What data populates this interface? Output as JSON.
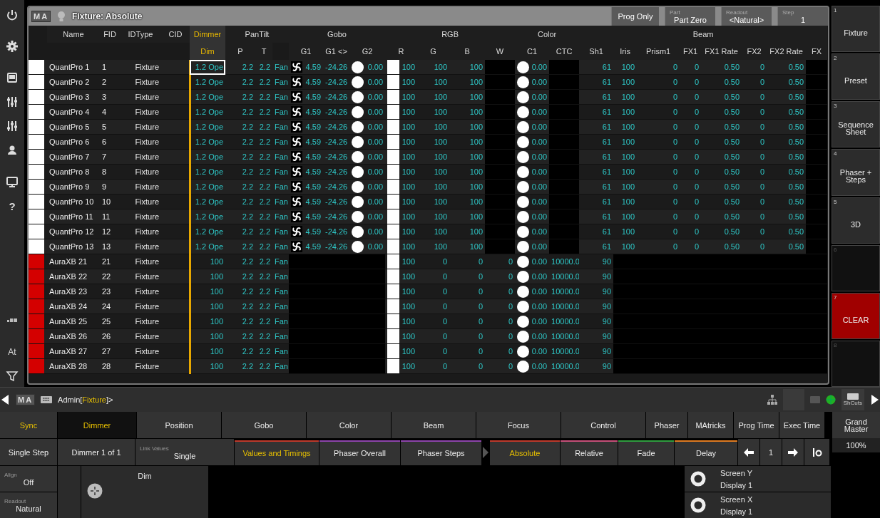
{
  "left_toolbar": {
    "help": "?",
    "at": "At"
  },
  "window": {
    "logo": "MA",
    "title": "Fixture: Absolute",
    "controls": [
      {
        "value": "Prog Only"
      },
      {
        "caption": "Part",
        "value": "Part Zero"
      },
      {
        "caption": "Readout",
        "value": "<Natural>"
      },
      {
        "caption": "Step",
        "value": "1"
      }
    ]
  },
  "table": {
    "groups": [
      {
        "label": "Name",
        "selected": false,
        "columns": [
          {
            "kind": "info"
          }
        ]
      },
      {
        "label": "FID",
        "selected": false,
        "columns": [
          {
            "kind": "info"
          }
        ]
      },
      {
        "label": "IDType",
        "selected": false,
        "columns": [
          {
            "kind": "info"
          }
        ]
      },
      {
        "label": "CID",
        "selected": false,
        "columns": [
          {
            "kind": "info"
          }
        ]
      },
      {
        "label": "Dimmer",
        "selected": true,
        "columns": [
          {
            "label": "Dim",
            "kind": "attr"
          }
        ]
      },
      {
        "label": "PanTilt",
        "selected": false,
        "columns": [
          {
            "label": "P",
            "kind": "attr"
          },
          {
            "label": "T",
            "kind": "attr"
          },
          {
            "kind": "attr"
          }
        ]
      },
      {
        "label": "Gobo",
        "selected": false,
        "columns": [
          {
            "label": "G1",
            "kind": "gobo"
          },
          {
            "label": "G1 <>",
            "kind": "attr"
          },
          {
            "label": "G2",
            "kind": "wheel"
          }
        ]
      },
      {
        "label": "RGB",
        "selected": false,
        "columns": [
          {
            "label": "R",
            "kind": "swatch"
          },
          {
            "label": "G",
            "kind": "attr"
          },
          {
            "label": "B",
            "kind": "attr"
          },
          {
            "label": "W",
            "kind": "attr"
          }
        ]
      },
      {
        "label": "Color",
        "selected": false,
        "columns": [
          {
            "label": "C1",
            "kind": "wheel"
          },
          {
            "label": "CTC",
            "kind": "attr"
          }
        ]
      },
      {
        "label": "Beam",
        "selected": false,
        "columns": [
          {
            "label": "Sh1",
            "kind": "attr"
          },
          {
            "label": "Iris",
            "kind": "attr"
          },
          {
            "label": "Prism1",
            "kind": "attr"
          },
          {
            "label": "FX1",
            "kind": "attr"
          },
          {
            "label": "FX1 Rate",
            "kind": "attr"
          },
          {
            "label": "FX2",
            "kind": "attr"
          },
          {
            "label": "FX2 Rate",
            "kind": "attr"
          },
          {
            "label": "FX",
            "kind": "attr"
          }
        ]
      }
    ],
    "rows": [
      {
        "color": "#ffffff",
        "selected": true,
        "cells": [
          "QuantPro 1",
          "1",
          "Fixture",
          null,
          "1.2 Ope",
          "2.2",
          "2.2",
          "Fan",
          "4.59",
          "-24.26",
          "0.00",
          "100",
          "100",
          "100",
          null,
          "0.00",
          null,
          "61",
          "100",
          "0",
          "0",
          "0.50",
          "0",
          "0.50",
          null
        ]
      },
      {
        "color": "#ffffff",
        "selected": false,
        "cells": [
          "QuantPro 2",
          "2",
          "Fixture",
          null,
          "1.2 Ope",
          "2.2",
          "2.2",
          "Fan",
          "4.59",
          "-24.26",
          "0.00",
          "100",
          "100",
          "100",
          null,
          "0.00",
          null,
          "61",
          "100",
          "0",
          "0",
          "0.50",
          "0",
          "0.50",
          null
        ]
      },
      {
        "color": "#ffffff",
        "selected": false,
        "cells": [
          "QuantPro 3",
          "3",
          "Fixture",
          null,
          "1.2 Ope",
          "2.2",
          "2.2",
          "Fan",
          "4.59",
          "-24.26",
          "0.00",
          "100",
          "100",
          "100",
          null,
          "0.00",
          null,
          "61",
          "100",
          "0",
          "0",
          "0.50",
          "0",
          "0.50",
          null
        ]
      },
      {
        "color": "#ffffff",
        "selected": false,
        "cells": [
          "QuantPro 4",
          "4",
          "Fixture",
          null,
          "1.2 Ope",
          "2.2",
          "2.2",
          "Fan",
          "4.59",
          "-24.26",
          "0.00",
          "100",
          "100",
          "100",
          null,
          "0.00",
          null,
          "61",
          "100",
          "0",
          "0",
          "0.50",
          "0",
          "0.50",
          null
        ]
      },
      {
        "color": "#ffffff",
        "selected": false,
        "cells": [
          "QuantPro 5",
          "5",
          "Fixture",
          null,
          "1.2 Ope",
          "2.2",
          "2.2",
          "Fan",
          "4.59",
          "-24.26",
          "0.00",
          "100",
          "100",
          "100",
          null,
          "0.00",
          null,
          "61",
          "100",
          "0",
          "0",
          "0.50",
          "0",
          "0.50",
          null
        ]
      },
      {
        "color": "#ffffff",
        "selected": false,
        "cells": [
          "QuantPro 6",
          "6",
          "Fixture",
          null,
          "1.2 Ope",
          "2.2",
          "2.2",
          "Fan",
          "4.59",
          "-24.26",
          "0.00",
          "100",
          "100",
          "100",
          null,
          "0.00",
          null,
          "61",
          "100",
          "0",
          "0",
          "0.50",
          "0",
          "0.50",
          null
        ]
      },
      {
        "color": "#ffffff",
        "selected": false,
        "cells": [
          "QuantPro 7",
          "7",
          "Fixture",
          null,
          "1.2 Ope",
          "2.2",
          "2.2",
          "Fan",
          "4.59",
          "-24.26",
          "0.00",
          "100",
          "100",
          "100",
          null,
          "0.00",
          null,
          "61",
          "100",
          "0",
          "0",
          "0.50",
          "0",
          "0.50",
          null
        ]
      },
      {
        "color": "#ffffff",
        "selected": false,
        "cells": [
          "QuantPro 8",
          "8",
          "Fixture",
          null,
          "1.2 Ope",
          "2.2",
          "2.2",
          "Fan",
          "4.59",
          "-24.26",
          "0.00",
          "100",
          "100",
          "100",
          null,
          "0.00",
          null,
          "61",
          "100",
          "0",
          "0",
          "0.50",
          "0",
          "0.50",
          null
        ]
      },
      {
        "color": "#ffffff",
        "selected": false,
        "cells": [
          "QuantPro 9",
          "9",
          "Fixture",
          null,
          "1.2 Ope",
          "2.2",
          "2.2",
          "Fan",
          "4.59",
          "-24.26",
          "0.00",
          "100",
          "100",
          "100",
          null,
          "0.00",
          null,
          "61",
          "100",
          "0",
          "0",
          "0.50",
          "0",
          "0.50",
          null
        ]
      },
      {
        "color": "#ffffff",
        "selected": false,
        "cells": [
          "QuantPro 10",
          "10",
          "Fixture",
          null,
          "1.2 Ope",
          "2.2",
          "2.2",
          "Fan",
          "4.59",
          "-24.26",
          "0.00",
          "100",
          "100",
          "100",
          null,
          "0.00",
          null,
          "61",
          "100",
          "0",
          "0",
          "0.50",
          "0",
          "0.50",
          null
        ]
      },
      {
        "color": "#ffffff",
        "selected": false,
        "cells": [
          "QuantPro 11",
          "11",
          "Fixture",
          null,
          "1.2 Ope",
          "2.2",
          "2.2",
          "Fan",
          "4.59",
          "-24.26",
          "0.00",
          "100",
          "100",
          "100",
          null,
          "0.00",
          null,
          "61",
          "100",
          "0",
          "0",
          "0.50",
          "0",
          "0.50",
          null
        ]
      },
      {
        "color": "#ffffff",
        "selected": false,
        "cells": [
          "QuantPro 12",
          "12",
          "Fixture",
          null,
          "1.2 Ope",
          "2.2",
          "2.2",
          "Fan",
          "4.59",
          "-24.26",
          "0.00",
          "100",
          "100",
          "100",
          null,
          "0.00",
          null,
          "61",
          "100",
          "0",
          "0",
          "0.50",
          "0",
          "0.50",
          null
        ]
      },
      {
        "color": "#ffffff",
        "selected": false,
        "cells": [
          "QuantPro 13",
          "13",
          "Fixture",
          null,
          "1.2 Ope",
          "2.2",
          "2.2",
          "Fan",
          "4.59",
          "-24.26",
          "0.00",
          "100",
          "100",
          "100",
          null,
          "0.00",
          null,
          "61",
          "100",
          "0",
          "0",
          "0.50",
          "0",
          "0.50",
          null
        ]
      },
      {
        "color": "#d40000",
        "selected": false,
        "cells": [
          "AuraXB 21",
          "21",
          "Fixture",
          null,
          "100",
          "2.2",
          "2.2",
          "Fan",
          null,
          null,
          null,
          "100",
          "0",
          "0",
          "0",
          "0.00",
          "10000.0",
          "90",
          null,
          null,
          null,
          null,
          null,
          null,
          null
        ]
      },
      {
        "color": "#d40000",
        "selected": false,
        "cells": [
          "AuraXB 22",
          "22",
          "Fixture",
          null,
          "100",
          "2.2",
          "2.2",
          "Fan",
          null,
          null,
          null,
          "100",
          "0",
          "0",
          "0",
          "0.00",
          "10000.0",
          "90",
          null,
          null,
          null,
          null,
          null,
          null,
          null
        ]
      },
      {
        "color": "#d40000",
        "selected": false,
        "cells": [
          "AuraXB 23",
          "23",
          "Fixture",
          null,
          "100",
          "2.2",
          "2.2",
          "Fan",
          null,
          null,
          null,
          "100",
          "0",
          "0",
          "0",
          "0.00",
          "10000.0",
          "90",
          null,
          null,
          null,
          null,
          null,
          null,
          null
        ]
      },
      {
        "color": "#d40000",
        "selected": false,
        "cells": [
          "AuraXB 24",
          "24",
          "Fixture",
          null,
          "100",
          "2.2",
          "2.2",
          "Fan",
          null,
          null,
          null,
          "100",
          "0",
          "0",
          "0",
          "0.00",
          "10000.0",
          "90",
          null,
          null,
          null,
          null,
          null,
          null,
          null
        ]
      },
      {
        "color": "#d40000",
        "selected": false,
        "cells": [
          "AuraXB 25",
          "25",
          "Fixture",
          null,
          "100",
          "2.2",
          "2.2",
          "Fan",
          null,
          null,
          null,
          "100",
          "0",
          "0",
          "0",
          "0.00",
          "10000.0",
          "90",
          null,
          null,
          null,
          null,
          null,
          null,
          null
        ]
      },
      {
        "color": "#d40000",
        "selected": false,
        "cells": [
          "AuraXB 26",
          "26",
          "Fixture",
          null,
          "100",
          "2.2",
          "2.2",
          "Fan",
          null,
          null,
          null,
          "100",
          "0",
          "0",
          "0",
          "0.00",
          "10000.0",
          "90",
          null,
          null,
          null,
          null,
          null,
          null,
          null
        ]
      },
      {
        "color": "#d40000",
        "selected": false,
        "cells": [
          "AuraXB 27",
          "27",
          "Fixture",
          null,
          "100",
          "2.2",
          "2.2",
          "Fan",
          null,
          null,
          null,
          "100",
          "0",
          "0",
          "0",
          "0.00",
          "10000.0",
          "90",
          null,
          null,
          null,
          null,
          null,
          null,
          null
        ]
      },
      {
        "color": "#d40000",
        "selected": false,
        "cells": [
          "AuraXB 28",
          "28",
          "Fixture",
          null,
          "100",
          "2.2",
          "2.2",
          "Fan",
          null,
          null,
          null,
          "100",
          "0",
          "0",
          "0",
          "0.00",
          "10000.0",
          "90",
          null,
          null,
          null,
          null,
          null,
          null,
          null
        ]
      }
    ]
  },
  "views": [
    {
      "number": "1",
      "label": "Fixture",
      "kind": "view"
    },
    {
      "number": "2",
      "label": "Preset",
      "kind": "view"
    },
    {
      "number": "3",
      "label": "Sequence Sheet",
      "kind": "view"
    },
    {
      "number": "4",
      "label": "Phaser + Steps",
      "kind": "view"
    },
    {
      "number": "5",
      "label": "3D",
      "kind": "view"
    },
    {
      "number": "6",
      "kind": "empty"
    },
    {
      "number": "7",
      "label": "CLEAR",
      "kind": "clear"
    },
    {
      "number": "8",
      "kind": "empty"
    }
  ],
  "command_line": {
    "logo": "MA",
    "prompt": [
      {
        "text": "Admin[",
        "highlight": false
      },
      {
        "text": "Fixture",
        "highlight": true
      },
      {
        "text": "]>",
        "highlight": false
      }
    ],
    "shortcuts": "ShCuts"
  },
  "encoder_bar": {
    "sync": {
      "label": "Sync",
      "on": true
    },
    "feature_tabs": [
      {
        "label": "Dimmer",
        "selected": true
      },
      {
        "label": "Position",
        "selected": false
      },
      {
        "label": "Gobo",
        "selected": false
      },
      {
        "label": "Color",
        "selected": false
      },
      {
        "label": "Beam",
        "selected": false
      },
      {
        "label": "Focus",
        "selected": false
      },
      {
        "label": "Control",
        "selected": false
      },
      {
        "label": "Phaser",
        "selected": false
      },
      {
        "label": "MAtricks",
        "selected": false
      },
      {
        "label": "Prog Time",
        "selected": false
      },
      {
        "label": "Exec Time",
        "selected": false
      }
    ],
    "single_step": "Single Step",
    "attribute_page": "Dimmer 1 of 1",
    "link_values": {
      "caption": "Link Values",
      "value": "Single"
    },
    "layer_tabs": [
      {
        "label": "Values and Timings",
        "color": "#c0392b",
        "selected": true
      },
      {
        "label": "Phaser Overall",
        "color": "#8e44ad",
        "selected": false
      },
      {
        "label": "Phaser Steps",
        "color": "#8e44ad",
        "selected": false
      }
    ],
    "mode_tabs": [
      {
        "label": "Absolute",
        "color": "#c0392b",
        "selected": true
      },
      {
        "label": "Relative",
        "color": "#c8507a",
        "selected": false
      },
      {
        "label": "Fade",
        "color": "#2e9e3e",
        "selected": false
      },
      {
        "label": "Delay",
        "color": "#e07b20",
        "selected": false
      }
    ],
    "step": "1",
    "align": {
      "caption": "Align",
      "value": "Off"
    },
    "readout": {
      "caption": "Readout",
      "value": "Natural"
    },
    "encoder": {
      "label": "Dim"
    },
    "screen_encoders": [
      {
        "label": "Screen Y",
        "value": "Display 1"
      },
      {
        "label": "Screen X",
        "value": "Display 1"
      }
    ],
    "grand_master": {
      "label": "Grand Master",
      "value": "100%"
    }
  }
}
